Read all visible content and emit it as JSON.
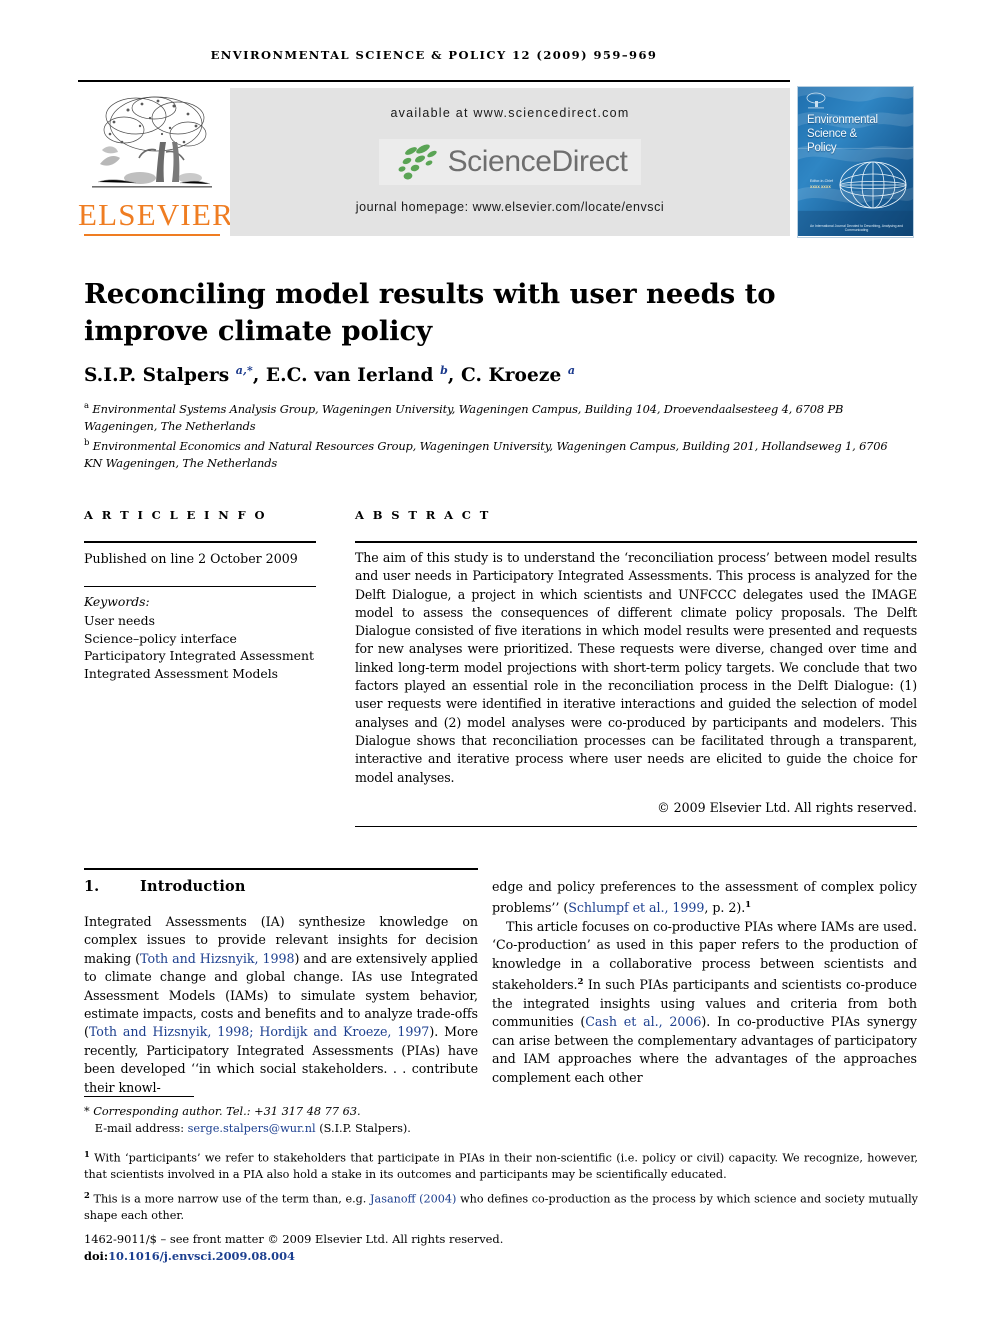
{
  "running_head": "ENVIRONMENTAL SCIENCE & POLICY 12 (2009) 959–969",
  "masthead": {
    "publisher_name": "ELSEVIER",
    "available_at": "available at www.sciencedirect.com",
    "sciencedirect_wordmark": "ScienceDirect",
    "journal_homepage": "journal homepage: www.elsevier.com/locate/envsci"
  },
  "cover": {
    "line1": "Environmental",
    "line2": "Science &",
    "line3": "Policy",
    "editor_label": "Editor-in-Chief",
    "editor_name": "xxxx xxxx",
    "footer": "An International Journal Devoted to Describing, Analysing and Communicating"
  },
  "article": {
    "title": "Reconciling model results with user needs to improve climate policy",
    "authors_html": "S.I.P. Stalpers <sup>a,*</sup>, E.C. van Ierland <sup>b</sup>, C. Kroeze <sup>a</sup>",
    "affiliation_a": "Environmental Systems Analysis Group, Wageningen University, Wageningen Campus, Building 104, Droevendaalsesteeg 4, 6708 PB Wageningen, The Netherlands",
    "affiliation_b": "Environmental Economics and Natural Resources Group, Wageningen University, Wageningen Campus, Building 201, Hollandseweg 1, 6706 KN Wageningen, The Netherlands"
  },
  "article_info": {
    "heading": "A R T I C L E   I N F O",
    "published": "Published on line 2 October 2009",
    "keywords_heading": "Keywords:",
    "keywords": [
      "User needs",
      "Science–policy interface",
      "Participatory Integrated Assessment",
      "Integrated Assessment Models"
    ]
  },
  "abstract": {
    "heading": "A B S T R A C T",
    "text": "The aim of this study is to understand the ‘reconciliation process’ between model results and user needs in Participatory Integrated Assessments. This process is analyzed for the Delft Dialogue, a project in which scientists and UNFCCC delegates used the IMAGE model to assess the consequences of different climate policy proposals. The Delft Dialogue consisted of five iterations in which model results were presented and requests for new analyses were prioritized. These requests were diverse, changed over time and linked long-term model projections with short-term policy targets. We conclude that two factors played an essential role in the reconciliation process in the Delft Dialogue: (1) user requests were identified in iterative interactions and guided the selection of model analyses and (2) model analyses were co-produced by participants and modelers. This Dialogue shows that reconciliation processes can be facilitated through a transparent, interactive and iterative process where user needs are elicited to guide the choice for model analyses.",
    "copyright": "© 2009 Elsevier Ltd. All rights reserved."
  },
  "section": {
    "number": "1.",
    "title": "Introduction"
  },
  "body": {
    "left_column_html": "Integrated Assessments (IA) synthesize knowledge on complex issues to provide relevant insights for decision making (<span class=\"cit\">Toth and Hizsnyik, 1998</span>) and are extensively applied to climate change and global change. IAs use Integrated Assessment Models (IAMs) to simulate system behavior, estimate impacts, costs and benefits and to analyze trade-offs (<span class=\"cit\">Toth and Hizsnyik, 1998; Hordijk and Kroeze, 1997</span>). More recently, Participatory Integrated Assessments (PIAs) have been developed ‘‘in which social stakeholders. . . contribute their knowl-",
    "right_column_para1_html": "edge and policy preferences to the assessment of complex policy problems’’ (<span class=\"cit\">Schlumpf et al., 1999</span>, p. 2).<sup class=\"fn\">1</sup>",
    "right_column_para2_html": "This article focuses on co-productive PIAs where IAMs are used. ‘Co-production’ as used in this paper refers to the production of knowledge in a collaborative process between scientists and stakeholders.<sup class=\"fn\">2</sup> In such PIAs participants and scientists co-produce the integrated insights using values and criteria from both communities (<span class=\"cit\">Cash et al., 2006</span>). In co-productive PIAs synergy can arise between the complementary advantages of participatory and IAM approaches where the advantages of the approaches complement each other"
  },
  "footnotes": {
    "corresponding_html": "<span class=\"star\">* Corresponding author. Tel.: +31 317 48 77 63.</span><br>&nbsp;&nbsp;&nbsp;E-mail address: <span class=\"cit\">serge.stalpers@wur.nl</span> (S.I.P. Stalpers).",
    "note1_html": "<span class=\"mark\">1</span> With ‘participants’ we refer to stakeholders that participate in PIAs in their non-scientific (i.e. policy or civil) capacity. We recognize, however, that scientists involved in a PIA also hold a stake in its outcomes and participants may be scientifically educated.",
    "note2_html": "<span class=\"mark\">2</span> This is a more narrow use of the term than, e.g. <span class=\"cit\">Jasanoff (2004)</span> who defines co-production as the process by which science and society mutually shape each other.",
    "issn_line": "1462-9011/$ – see front matter © 2009 Elsevier Ltd. All rights reserved.",
    "doi_prefix": "doi:",
    "doi_value": "10.1016/j.envsci.2009.08.004"
  },
  "colors": {
    "link_blue": "#1c3f8f",
    "elsevier_orange": "#ef7d22",
    "sciencedirect_green": "#5aa455",
    "sciencedirect_gray": "#6e6e6e",
    "band_gray": "#e3e3e3"
  }
}
